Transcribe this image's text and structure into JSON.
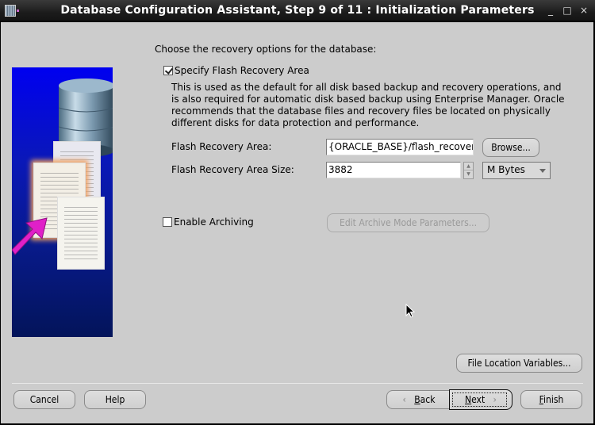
{
  "window": {
    "title": "Database Configuration Assistant, Step 9 of 11 : Initialization Parameters",
    "controls": {
      "minimize": "_",
      "maximize": "□",
      "close": "×"
    }
  },
  "page": {
    "intro": "Choose the recovery options for the database:",
    "flash_recovery": {
      "checkbox_label": "Specify Flash Recovery Area",
      "checked": true,
      "description": "This is used as the default for all disk based backup and recovery operations, and is also required for automatic disk based backup using Enterprise Manager. Oracle recommends that the database files and recovery files be located on physically different disks for data protection and performance.",
      "area_label": "Flash Recovery Area:",
      "area_value": "{ORACLE_BASE}/flash_recovery_",
      "browse_label": "Browse...",
      "size_label": "Flash Recovery Area Size:",
      "size_value": "3882",
      "size_unit": "M Bytes"
    },
    "archiving": {
      "checkbox_label": "Enable Archiving",
      "checked": false,
      "edit_button_label": "Edit Archive Mode Parameters..."
    },
    "file_location_button": "File Location Variables..."
  },
  "footer": {
    "cancel": "Cancel",
    "help": "Help",
    "back_mnemonic": "B",
    "back_rest": "ack",
    "next_mnemonic": "N",
    "next_rest": "ext",
    "finish_mnemonic": "F",
    "finish_rest": "inish"
  }
}
